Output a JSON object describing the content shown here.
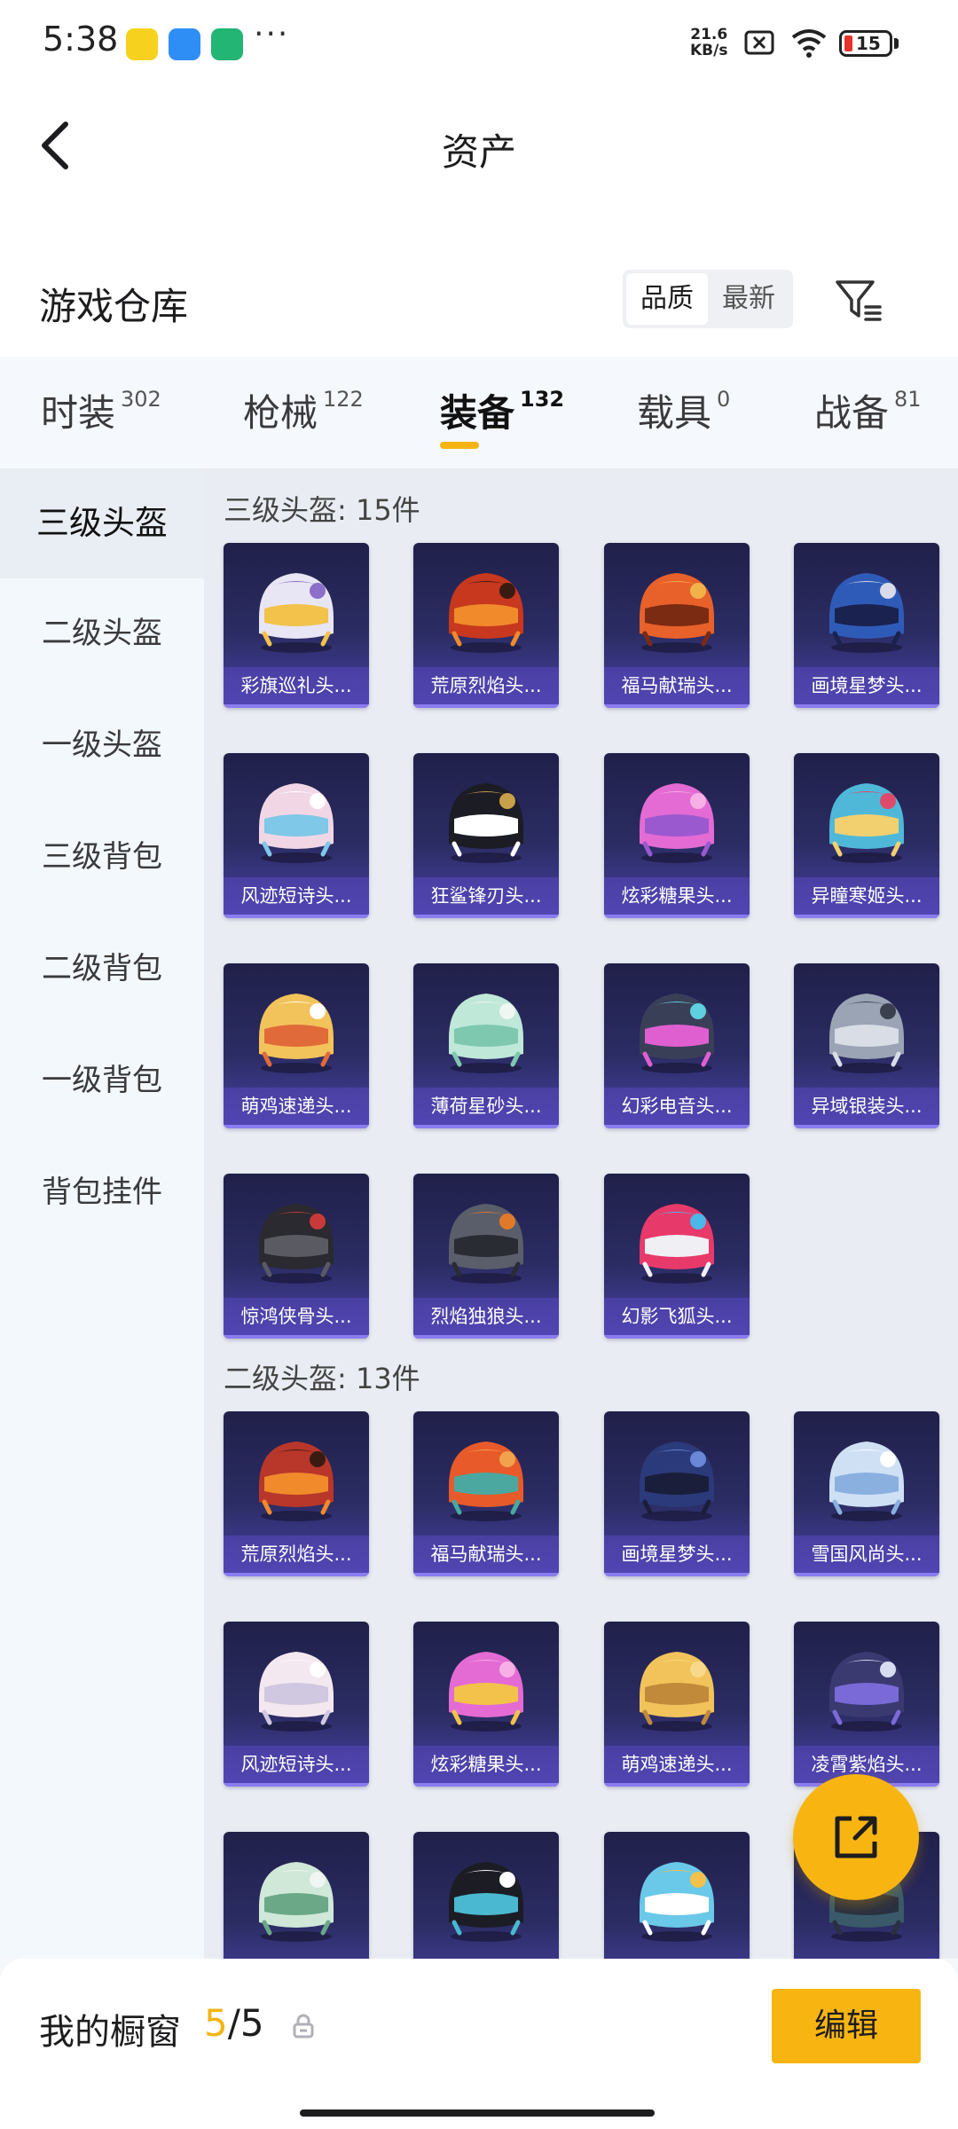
{
  "status_bar": {
    "time": "5:38",
    "more": "···",
    "net_speed_value": "21.6",
    "net_speed_unit": "KB/s",
    "battery": "15"
  },
  "header": {
    "title": "资产"
  },
  "section": {
    "title": "游戏仓库",
    "sort_options": [
      "品质",
      "最新"
    ],
    "sort_selected": "品质"
  },
  "tabs": [
    {
      "label": "时装",
      "count": "302"
    },
    {
      "label": "枪械",
      "count": "122"
    },
    {
      "label": "装备",
      "count": "132"
    },
    {
      "label": "载具",
      "count": "0"
    },
    {
      "label": "战备",
      "count": "81"
    }
  ],
  "active_tab": "装备",
  "sidenav": [
    "三级头盔",
    "二级头盔",
    "一级头盔",
    "三级背包",
    "二级背包",
    "一级背包",
    "背包挂件"
  ],
  "active_sidenav": "三级头盔",
  "groups": [
    {
      "title": "三级头盔: 15件",
      "items": [
        {
          "name": "彩旗巡礼头...",
          "colors": [
            "#e8e6f4",
            "#8b6fc9",
            "#f2c24b"
          ]
        },
        {
          "name": "荒原烈焰头...",
          "colors": [
            "#c7381e",
            "#3a1b12",
            "#f08a2b"
          ]
        },
        {
          "name": "福马献瑞头...",
          "colors": [
            "#e8612a",
            "#f2b24a",
            "#7a2b12"
          ]
        },
        {
          "name": "画境星梦头...",
          "colors": [
            "#2f5bb8",
            "#d9dbe8",
            "#1a2250"
          ]
        },
        {
          "name": "风迹短诗头...",
          "colors": [
            "#f1d7e6",
            "#ffffff",
            "#7fc8e8"
          ]
        },
        {
          "name": "狂鲨锋刃头...",
          "colors": [
            "#1c1c24",
            "#c9a04a",
            "#ffffff"
          ]
        },
        {
          "name": "炫彩糖果头...",
          "colors": [
            "#e46bd4",
            "#f7b0e6",
            "#9b59d0"
          ]
        },
        {
          "name": "异瞳寒姬头...",
          "colors": [
            "#4fb8d8",
            "#e04a6a",
            "#f2d070"
          ]
        },
        {
          "name": "萌鸡速递头...",
          "colors": [
            "#f2c35a",
            "#ffffff",
            "#e06a3a"
          ]
        },
        {
          "name": "薄荷星砂头...",
          "colors": [
            "#bfe8d8",
            "#f0f6f2",
            "#7fc8b0"
          ]
        },
        {
          "name": "幻彩电音头...",
          "colors": [
            "#3a3f58",
            "#5fd0e0",
            "#e05fd0"
          ]
        },
        {
          "name": "异域银装头...",
          "colors": [
            "#9aa4b4",
            "#3a404e",
            "#d8dde6"
          ]
        },
        {
          "name": "惊鸿侠骨头...",
          "colors": [
            "#2a2a30",
            "#c83a3a",
            "#5a5a62"
          ]
        },
        {
          "name": "烈焰独狼头...",
          "colors": [
            "#5a5e6a",
            "#e07a2a",
            "#2a2c34"
          ]
        },
        {
          "name": "幻影飞狐头...",
          "colors": [
            "#e83a6a",
            "#4ab8e8",
            "#f0f0f4"
          ]
        }
      ]
    },
    {
      "title": "二级头盔: 13件",
      "items": [
        {
          "name": "荒原烈焰头...",
          "colors": [
            "#b8362a",
            "#3a1b12",
            "#f08a2b"
          ]
        },
        {
          "name": "福马献瑞头...",
          "colors": [
            "#e85a2a",
            "#f2a24a",
            "#4aa8a0"
          ]
        },
        {
          "name": "画境星梦头...",
          "colors": [
            "#2a3a7a",
            "#6a88d8",
            "#1a1e3a"
          ]
        },
        {
          "name": "雪国风尚头...",
          "colors": [
            "#cfe0f4",
            "#ffffff",
            "#8ab0e0"
          ]
        },
        {
          "name": "风迹短诗头...",
          "colors": [
            "#f4e8f0",
            "#ffffff",
            "#d0c8e0"
          ]
        },
        {
          "name": "炫彩糖果头...",
          "colors": [
            "#e46bd4",
            "#f7b0e6",
            "#f2c24b"
          ]
        },
        {
          "name": "萌鸡速递头...",
          "colors": [
            "#f2c35a",
            "#f8d88a",
            "#c08a3a"
          ]
        },
        {
          "name": "凌霄紫焰头...",
          "colors": [
            "#3a3a70",
            "#d8dcf0",
            "#7a6ad8"
          ]
        },
        {
          "name": "",
          "colors": [
            "#cfe8d8",
            "#f0f6f2",
            "#6aa888"
          ]
        },
        {
          "name": "",
          "colors": [
            "#1c1c24",
            "#ffffff",
            "#4ab8d0"
          ]
        },
        {
          "name": "",
          "colors": [
            "#6ac8e8",
            "#f2c24b",
            "#ffffff"
          ]
        },
        {
          "name": "",
          "colors": [
            "#3a5a6a",
            "#9ad0d8",
            "#2a3040"
          ]
        }
      ]
    }
  ],
  "bottom_bar": {
    "label": "我的橱窗",
    "count_current": "5",
    "count_sep_total": "/5",
    "edit_label": "编辑"
  },
  "accent_color": "#f5b414"
}
